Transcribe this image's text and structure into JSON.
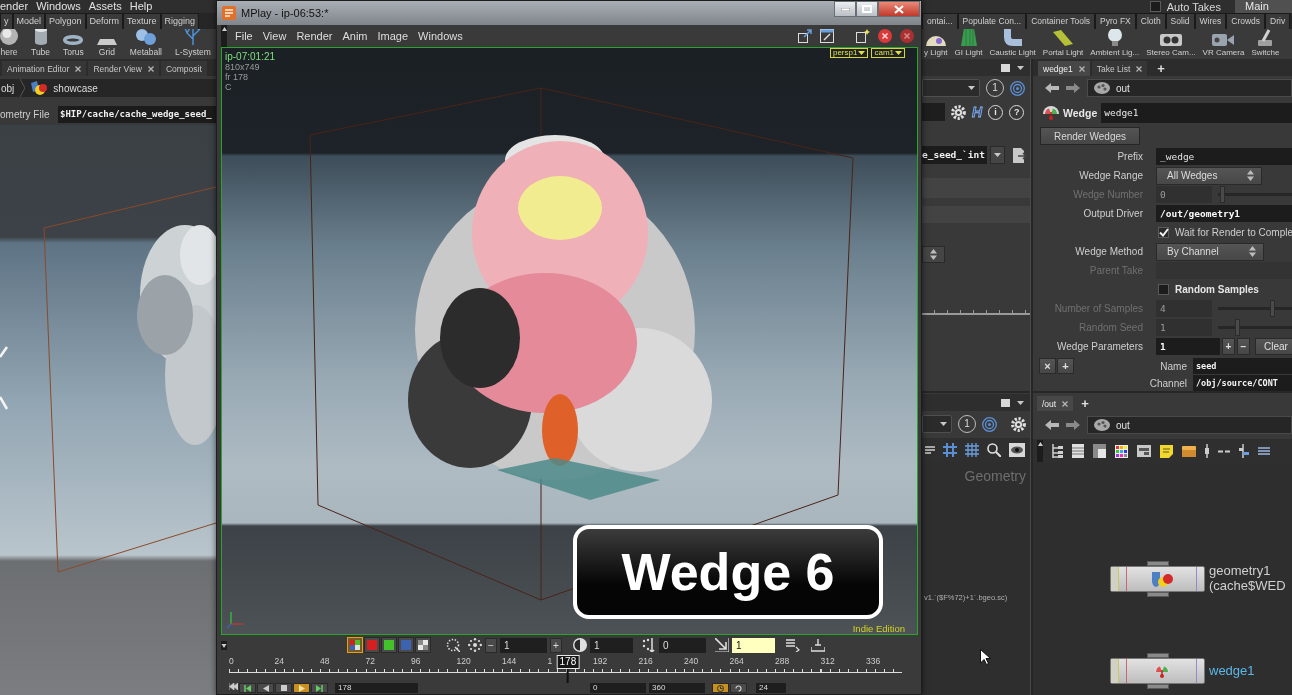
{
  "menu_bar": {
    "items": [
      "ender",
      "Windows",
      "Assets",
      "Help"
    ],
    "auto_takes": {
      "label": "Auto Takes",
      "checked": false
    },
    "desktop": "Main"
  },
  "shelf": {
    "left_tabs": [
      "y",
      "Model",
      "Polygon",
      "Deform",
      "Texture",
      "Rigging"
    ],
    "right_tabs": [
      "ontai...",
      "Populate Con...",
      "Container Tools",
      "Pyro FX",
      "Cloth",
      "Solid",
      "Wires",
      "Crowds",
      "Driv"
    ],
    "left_tools": [
      {
        "label": "here",
        "kind": "sphere"
      },
      {
        "label": "Tube",
        "kind": "tube"
      },
      {
        "label": "Torus",
        "kind": "torus"
      },
      {
        "label": "Grid",
        "kind": "grid"
      },
      {
        "label": "Metaball",
        "kind": "metaball"
      },
      {
        "label": "L-System",
        "kind": "lsystem"
      }
    ],
    "right_tools": [
      {
        "label": "y Light",
        "kind": "sky"
      },
      {
        "label": "GI Light",
        "kind": "gi"
      },
      {
        "label": "Caustic Light",
        "kind": "caustic"
      },
      {
        "label": "Portal Light",
        "kind": "portal"
      },
      {
        "label": "Ambient Lig...",
        "kind": "ambient"
      },
      {
        "label": "Stereo Cam...",
        "kind": "stereo"
      },
      {
        "label": "VR Camera",
        "kind": "vr"
      },
      {
        "label": "Switche",
        "kind": "switcher"
      }
    ]
  },
  "scene_pane": {
    "tabs": [
      {
        "label": "Animation Editor",
        "selected": false
      },
      {
        "label": "Render View",
        "selected": false
      },
      {
        "label": "Composit",
        "selected": false
      }
    ],
    "path": [
      "obj",
      "showcase"
    ],
    "geometry_file": {
      "label": "ometry File",
      "value": "$HIP/cache/cache_wedge_seed_"
    }
  },
  "side_pane": {
    "view_number": "1",
    "glyph_buttons": [
      "H",
      "i",
      "?"
    ],
    "field_value": "e_seed_`int",
    "lower_view_number": "1",
    "network_type": "Geometry",
    "file_snippet": "v1.`($F%72)+1`.bgeo.sc)"
  },
  "parameter_pane": {
    "tabs": [
      {
        "label": "wedge1",
        "selected": true
      },
      {
        "label": "Take List",
        "selected": false
      }
    ],
    "new_tab": "+",
    "path": "out",
    "node_type": "Wedge",
    "node_name": "wedge1",
    "action_button": "Render Wedges",
    "params": [
      {
        "kind": "text",
        "label": "Prefix",
        "value": "_wedge",
        "modified": false,
        "disabled": false
      },
      {
        "kind": "menu",
        "label": "Wedge Range",
        "value": "All Wedges",
        "disabled": false
      },
      {
        "kind": "slider",
        "label": "Wedge Number",
        "value": "0",
        "disabled": true,
        "level": 0.03
      },
      {
        "kind": "text",
        "label": "Output Driver",
        "value": "/out/geometry1",
        "modified": true,
        "disabled": false
      },
      {
        "kind": "toggle",
        "label": "Wait for Render to Comple",
        "checked": true,
        "modified": false,
        "disabled": false
      },
      {
        "kind": "menu",
        "label": "Wedge Method",
        "value": "By Channel",
        "disabled": false
      },
      {
        "kind": "text",
        "label": "Parent Take",
        "disabled": true
      },
      {
        "kind": "toggle",
        "label": "Random Samples",
        "checked": false,
        "modified": true,
        "disabled": false
      },
      {
        "kind": "slider",
        "label": "Number of Samples",
        "value": "4",
        "disabled": true,
        "level": 0.75
      },
      {
        "kind": "slider",
        "label": "Random Seed",
        "value": "1",
        "disabled": true,
        "level": 0.25
      },
      {
        "kind": "multiparm",
        "label": "Wedge Parameters",
        "value": "1",
        "modified": true,
        "disabled": false,
        "add": "+",
        "remove": "−",
        "clear": "Clear"
      }
    ],
    "instance": {
      "remove": "×",
      "add": "+",
      "fields": [
        {
          "label": "Name",
          "value": "seed"
        },
        {
          "label": "Channel",
          "value": "/obj/source/CONT"
        }
      ]
    }
  },
  "network_pane": {
    "tabs": [
      {
        "label": "/out",
        "selected": true
      }
    ],
    "new_tab": "+",
    "path": "out",
    "nodes": [
      {
        "kind": "geometry",
        "name": "geometry1",
        "comment": "(cache$WED",
        "selected": false
      },
      {
        "kind": "wedge",
        "name": "wedge1",
        "selected": true
      }
    ]
  },
  "mplay": {
    "title": "MPlay - ip-06:53:*",
    "menu": [
      "File",
      "View",
      "Render",
      "Anim",
      "Image",
      "Windows"
    ],
    "image_name": "ip-07:01:21",
    "details": [
      "810x749",
      "fr 178",
      "C"
    ],
    "camera_menus": [
      "persp1",
      "cam1"
    ],
    "caption": "Wedge 6",
    "edition": "Indie Edition",
    "channels": [
      {
        "kind": "combined",
        "selected": true
      },
      {
        "kind": "single",
        "color": "#d42020",
        "selected": false
      },
      {
        "kind": "single",
        "color": "#44c22c",
        "selected": false
      },
      {
        "kind": "single",
        "color": "#3c62b0",
        "selected": false
      },
      {
        "kind": "alpha",
        "selected": false
      }
    ],
    "step": {
      "minus": "−",
      "value": "1",
      "plus": "+"
    },
    "fields": [
      {
        "kind": "plain",
        "value": "1"
      },
      {
        "kind": "plain",
        "value": "0"
      },
      {
        "kind": "highlight",
        "value": "1"
      }
    ],
    "timeline": {
      "ticks": [
        "0",
        "24",
        "48",
        "72",
        "96",
        "120",
        "144",
        "1",
        "192",
        "216",
        "240",
        "264",
        "288",
        "312",
        "336"
      ],
      "current_frame": "178",
      "level": 0.505
    },
    "transport": {
      "frame": "178",
      "start": "0",
      "end": "360",
      "fps": "24"
    }
  }
}
